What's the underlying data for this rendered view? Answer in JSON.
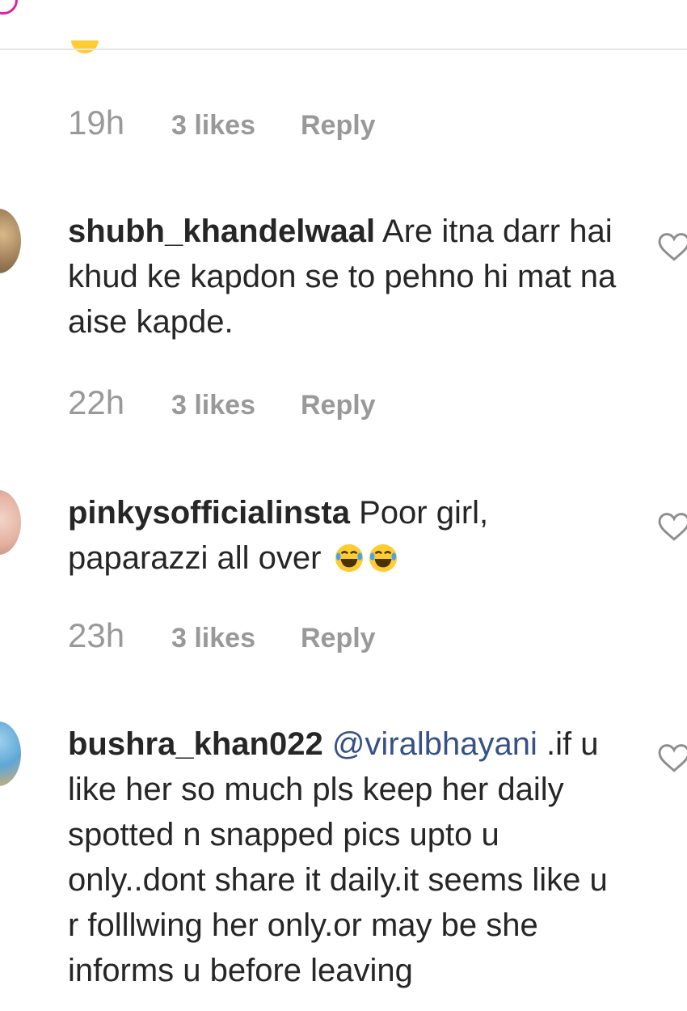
{
  "colors": {
    "text": "#262626",
    "meta": "#999999",
    "mention": "#385185",
    "divider": "#e6e6e6",
    "story_ring": "#d6249f"
  },
  "top_comment": {
    "time": "19h",
    "likes": "3 likes",
    "reply": "Reply"
  },
  "comments": [
    {
      "username": "shubh_khandelwaal",
      "text": " Are itna darr hai khud ke kapdon se to pehno hi mat na aise kapde.",
      "time": "22h",
      "likes": "3 likes",
      "reply": "Reply",
      "like_icon": "heart-outline-icon"
    },
    {
      "username": "pinkysofficialinsta",
      "text": " Poor girl, paparazzi all over",
      "emoji": "face-with-tears-of-joy x2",
      "time": "23h",
      "likes": "3 likes",
      "reply": "Reply",
      "like_icon": "heart-outline-icon"
    },
    {
      "username": "bushra_khan022",
      "mention": "@viralbhayani",
      "text": " .if u like her so much pls keep her daily spotted n snapped pics upto u only..dont share it daily.it seems like u r folllwing her only.or may be she informs u before leaving",
      "like_icon": "heart-outline-icon"
    }
  ]
}
